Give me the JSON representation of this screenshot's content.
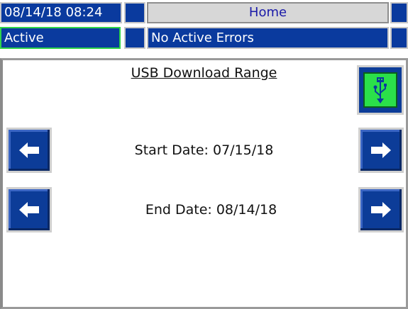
{
  "header": {
    "datetime": "08/14/18 08:24",
    "title": "Home",
    "status": "Active",
    "errors": "No Active Errors"
  },
  "main": {
    "heading": "USB Download Range",
    "start_label": "Start Date: 07/15/18",
    "end_label": "End Date: 08/14/18"
  },
  "icons": {
    "usb": "usb-icon",
    "left": "arrow-left-icon",
    "right": "arrow-right-icon"
  },
  "colors": {
    "bar_blue": "#0a3a9e",
    "title_gray": "#d7d7d7",
    "active_border": "#2fd44a",
    "usb_green": "#2be04a"
  }
}
